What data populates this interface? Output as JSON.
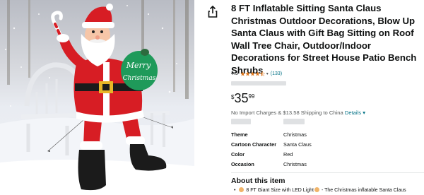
{
  "product": {
    "title": "8 FT Inflatable Sitting Santa Claus Christmas Outdoor Decorations, Blow Up Santa Claus with Gift Bag Sitting on Roof Wall Tree Chair, Outdoor/Indoor Decorations for Street House Patio Bench Shrubs",
    "image_alt": "Inflatable Santa Claus sitting on a bench in the snow holding a green gift bag",
    "bag_text_line1": "Merry",
    "bag_text_line2": "Christmas"
  },
  "rating": {
    "value": "4.5",
    "stars": 4.5,
    "count": "(133)",
    "chevron": "▾"
  },
  "price": {
    "symbol": "$",
    "whole": "35",
    "fraction": "99"
  },
  "shipping": {
    "text": "No Import Charges & $13.58 Shipping to China",
    "details_link": "Details",
    "chevron": "▾"
  },
  "attributes": [
    {
      "key": "Theme",
      "value": "Christmas"
    },
    {
      "key": "Cartoon Character",
      "value": "Santa Claus"
    },
    {
      "key": "Color",
      "value": "Red"
    },
    {
      "key": "Occasion",
      "value": "Christmas"
    }
  ],
  "about": {
    "heading": "About this item",
    "bullet_1_prefix": "8 FT Giant Size with LED Light",
    "bullet_1_suffix": "- The Christmas inflatable Santa Claus"
  },
  "icons": {
    "share": "share-icon",
    "star": "star-icon"
  },
  "colors": {
    "link": "#007185",
    "star": "#de7921",
    "santa_red": "#d71d24",
    "bag_green": "#1f9a5a"
  }
}
